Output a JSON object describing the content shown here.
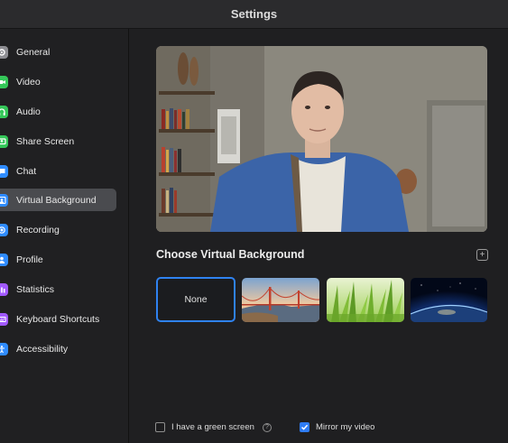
{
  "window": {
    "title": "Settings"
  },
  "sidebar": {
    "items": [
      {
        "label": "General",
        "icon": "gear-icon",
        "color": "#8e8e93"
      },
      {
        "label": "Video",
        "icon": "video-camera-icon",
        "color": "#34c759"
      },
      {
        "label": "Audio",
        "icon": "headphones-icon",
        "color": "#34c759"
      },
      {
        "label": "Share Screen",
        "icon": "share-screen-icon",
        "color": "#34c759"
      },
      {
        "label": "Chat",
        "icon": "chat-bubble-icon",
        "color": "#2f8cff"
      },
      {
        "label": "Virtual Background",
        "icon": "virtual-background-icon",
        "color": "#2f8cff",
        "active": true
      },
      {
        "label": "Recording",
        "icon": "record-icon",
        "color": "#2f8cff"
      },
      {
        "label": "Profile",
        "icon": "person-icon",
        "color": "#2f8cff"
      },
      {
        "label": "Statistics",
        "icon": "bar-chart-icon",
        "color": "#a259ff"
      },
      {
        "label": "Keyboard Shortcuts",
        "icon": "keyboard-icon",
        "color": "#a259ff"
      },
      {
        "label": "Accessibility",
        "icon": "accessibility-icon",
        "color": "#2f8cff"
      }
    ]
  },
  "main": {
    "section_title": "Choose Virtual Background",
    "add_label": "+",
    "thumbnails": [
      {
        "label": "None",
        "selected": true
      },
      {
        "name": "golden-gate-bridge"
      },
      {
        "name": "grass"
      },
      {
        "name": "earth-from-space"
      }
    ],
    "options": {
      "green_screen_label": "I have a green screen",
      "green_screen_checked": false,
      "help_label": "?",
      "mirror_label": "Mirror my video",
      "mirror_checked": true
    }
  },
  "accent_color": "#2e7cf6"
}
